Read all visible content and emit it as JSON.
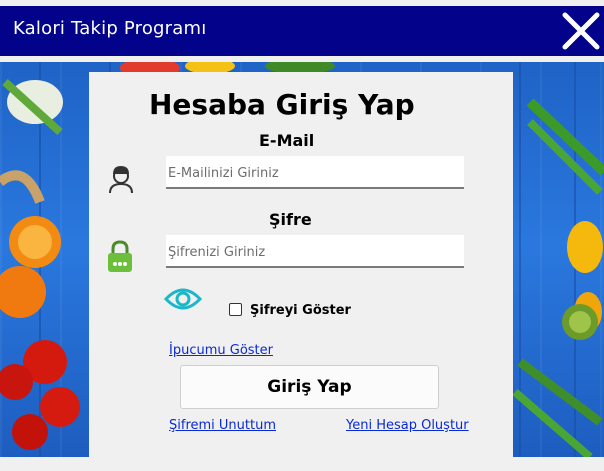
{
  "window": {
    "title": "Kalori Takip Programı",
    "close_icon": "close-icon"
  },
  "login": {
    "heading": "Hesaba Giriş Yap",
    "email_label": "E-Mail",
    "email_placeholder": "E-Mailinizi Giriniz",
    "email_value": "",
    "password_label": "Şifre",
    "password_placeholder": "Şifrenizi Giriniz",
    "password_value": "",
    "show_password_label": "Şifreyi Göster",
    "show_password_checked": false,
    "hint_link": "İpucumu Göster",
    "submit_label": "Giriş Yap",
    "forgot_link": "Şifremi Unuttum",
    "register_link": "Yeni Hesap Oluştur"
  },
  "colors": {
    "titlebar": "#02028b",
    "link": "#0a29d6",
    "lock": "#6cbf3b",
    "eye": "#19b7c9"
  },
  "icons": [
    "user-icon",
    "lock-icon",
    "eye-icon",
    "close-icon"
  ]
}
